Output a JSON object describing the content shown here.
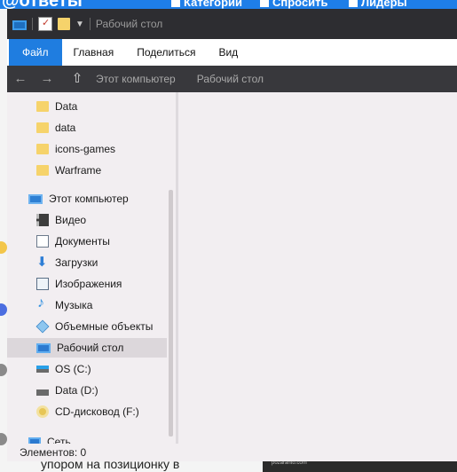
{
  "background_page": {
    "logo": "@ответы",
    "nav": [
      "Категории",
      "Спросить",
      "Лидеры"
    ],
    "bottom_text": "упором на позиционку в",
    "thumb_text": "pozaranto.com"
  },
  "window": {
    "title": "Рабочий стол",
    "ribbon_tabs": [
      "Файл",
      "Главная",
      "Поделиться",
      "Вид"
    ],
    "breadcrumb": [
      "Этот компьютер",
      "Рабочий стол"
    ],
    "nav_items": [
      {
        "label": "Data",
        "icon": "folder-icon"
      },
      {
        "label": "data",
        "icon": "folder-icon"
      },
      {
        "label": "icons-games",
        "icon": "folder-icon"
      },
      {
        "label": "Warframe",
        "icon": "folder-icon"
      },
      {
        "label": "Этот компьютер",
        "icon": "this-pc-icon"
      },
      {
        "label": "Видео",
        "icon": "video-icon"
      },
      {
        "label": "Документы",
        "icon": "documents-icon"
      },
      {
        "label": "Загрузки",
        "icon": "downloads-icon"
      },
      {
        "label": "Изображения",
        "icon": "pictures-icon"
      },
      {
        "label": "Музыка",
        "icon": "music-icon"
      },
      {
        "label": "Объемные объекты",
        "icon": "3d-objects-icon"
      },
      {
        "label": "Рабочий стол",
        "icon": "desktop-icon"
      },
      {
        "label": "OS (C:)",
        "icon": "os-drive-icon"
      },
      {
        "label": "Data (D:)",
        "icon": "drive-icon"
      },
      {
        "label": "CD-дисковод (F:)",
        "icon": "cd-drive-icon"
      },
      {
        "label": "Сеть",
        "icon": "network-icon"
      }
    ],
    "status": "Элементов: 0",
    "colors": {
      "accent": "#1f7de0",
      "titlebar": "#2d2d31",
      "address_bar": "#38383c",
      "pane": "#f2eef1",
      "selected": "#dcd7db"
    }
  }
}
